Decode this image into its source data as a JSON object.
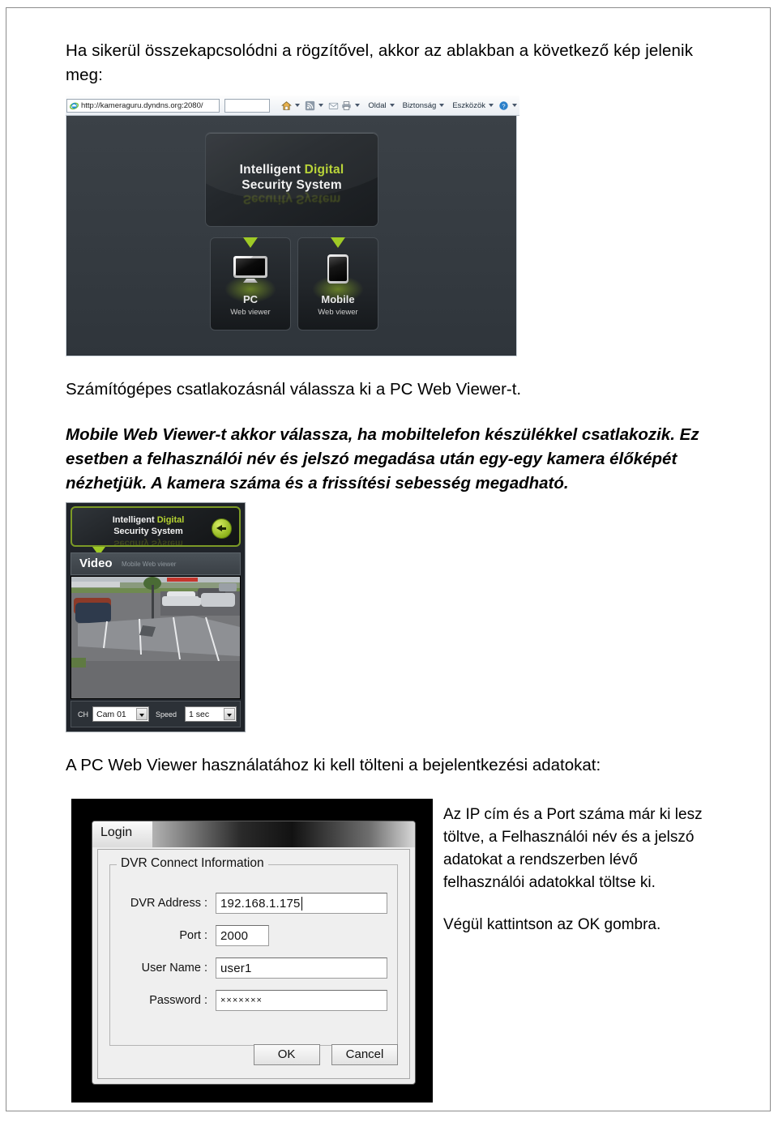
{
  "document": {
    "intro": "Ha sikerül összekapcsolódni a rögzítővel, akkor az ablakban a következő kép jelenik meg:",
    "para_pc": "Számítógépes csatlakozásnál válassza ki a PC Web Viewer-t.",
    "para_mobile": "Mobile Web Viewer-t akkor válassza, ha mobiltelefon készülékkel csatlakozik. Ez esetben a felhasználói név és jelszó megadása után egy-egy kamera élőképét nézhetjük. A kamera száma és a frissítési sebesség megadható.",
    "para_login": "A PC Web Viewer használatához ki kell tölteni a bejelentkezési adatokat:",
    "note_1": "Az IP cím és a Port száma már ki lesz töltve, a Felhasználói név és a jelszó adatokat a rendszerben lévő felhasználói adatokkal töltse ki.",
    "note_2": "Végül kattintson az OK gombra."
  },
  "browser": {
    "address": "http://kameraguru.dyndns.org:2080/",
    "search_placeholder": "",
    "toolbar": {
      "home_icon": "home-icon",
      "feeds_icon": "rss-feed-icon",
      "mail_icon": "mail-icon",
      "print_icon": "printer-icon",
      "menu_page": "Oldal",
      "menu_security": "Biztonság",
      "menu_tools": "Eszközök",
      "menu_help": "?"
    }
  },
  "viewer": {
    "logo_line1_a": "Intelligent ",
    "logo_line1_b": "Digital",
    "logo_line2": "Security System",
    "tiles": [
      {
        "icon": "monitor-icon",
        "label": "PC",
        "sub": "Web viewer"
      },
      {
        "icon": "mobile-phone-icon",
        "label": "Mobile",
        "sub": "Web viewer"
      }
    ]
  },
  "mobile_viewer": {
    "logo_line1_a": "Intelligent ",
    "logo_line1_b": "Digital",
    "logo_line2": "Security System",
    "back_icon": "back-arrow-icon",
    "section_title": "Video",
    "section_sub": "Mobile Web viewer",
    "channel_label": "CH",
    "channel_value": "Cam 01",
    "speed_label": "Speed",
    "speed_value": "1 sec"
  },
  "login_dialog": {
    "title": "Login",
    "group_title": "DVR Connect Information",
    "fields": [
      {
        "label": "DVR Address :",
        "value": "192.168.1.175"
      },
      {
        "label": "Port :",
        "value": "2000"
      },
      {
        "label": "User Name :",
        "value": "user1"
      },
      {
        "label": "Password :",
        "value": "×××××××"
      }
    ],
    "ok_label": "OK",
    "cancel_label": "Cancel"
  },
  "colors": {
    "accent_green": "#b6d331",
    "viewer_bg": "#3a4046",
    "dialog_bg": "#efefef"
  }
}
